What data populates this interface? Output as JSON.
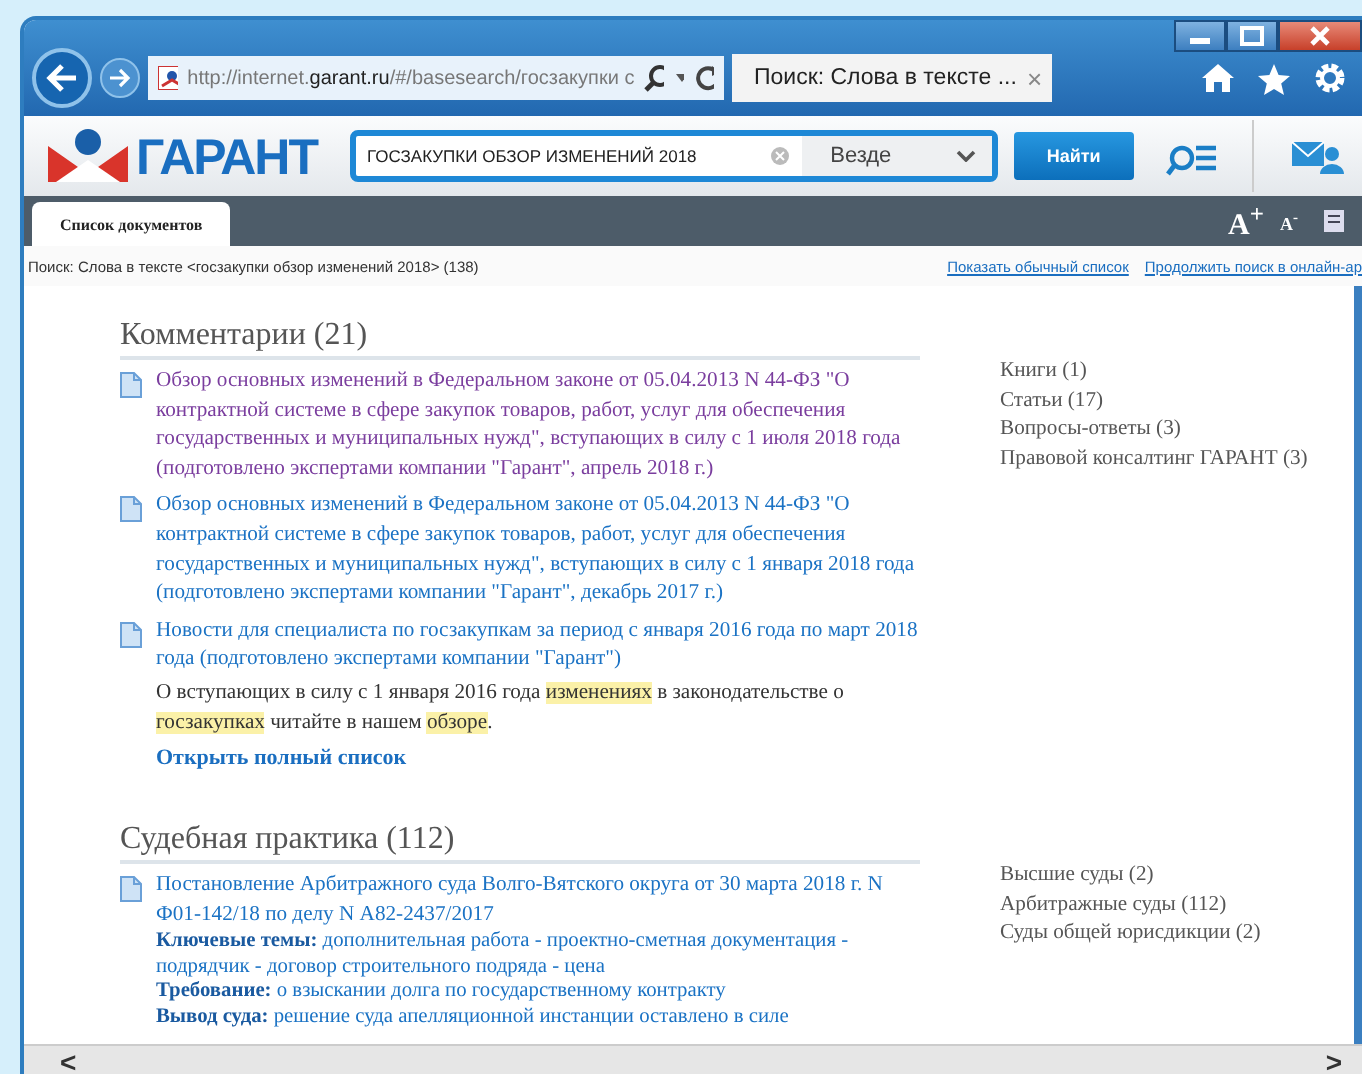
{
  "browser": {
    "address": "http://internet.**garant.ru**/#/basesearch/госзакупки с",
    "tab_title": "Поиск: Слова в тексте ...",
    "tab_close": "×"
  },
  "toolbar": {
    "logo": "ГАРАНТ",
    "search_value": "ГОСЗАКУПКИ ОБЗОР ИЗМЕНЕНИЙ 2018",
    "scope": "Везде",
    "search_button": "Найти"
  },
  "tabs": [
    {
      "label": "Список документов",
      "selected": true
    }
  ],
  "font_buttons": [
    "A$^{+}$",
    "A$^{-}$"
  ],
  "info": {
    "query": "Поиск: Слова в тексте <госзакупки обзор изменений 2018> (138)",
    "links": [
      "Показать обычный список",
      "Продолжить поиск в онлайн-ар"
    ]
  },
  "sections": [
    {
      "title": "Комментарии (21)",
      "items": [
        {
          "title": "Обзор основных изменений в Федеральном законе от 05.04.2013 N 44-ФЗ \"О контрактной системе в сфере закупок товаров, работ, услуг для обеспечения государственных и муниципальных нужд\", вступающих в силу с 1 июля 2018 года (подготовлено экспертами компании \"Гарант\", апрель 2018 г.)",
          "visited": true
        },
        {
          "title": "Обзор основных изменений в Федеральном законе от 05.04.2013 N 44-ФЗ \"О контрактной системе в сфере закупок товаров, работ, услуг для обеспечения государственных и муниципальных нужд\", вступающих в силу с 1 января 2018 года (подготовлено экспертами компании \"Гарант\", декабрь 2017 г.)",
          "visited": false
        },
        {
          "title": "Новости для специалиста по госзакупкам за период с января 2016 года по март 2018 года (подготовлено экспертами компании \"Гарант\")",
          "visited": false,
          "snippet": [
            {
              "text": "О вступающих в силу с 1 января 2016 года ",
              "highlight": false
            },
            {
              "text": "изменениях",
              "highlight": true
            },
            {
              "text": " в законодательстве о ",
              "highlight": false
            },
            {
              "text": "госзакупках",
              "highlight": true
            },
            {
              "text": " читайте в нашем ",
              "highlight": false
            },
            {
              "text": "обзоре",
              "highlight": true
            },
            {
              "text": ".",
              "highlight": false
            }
          ]
        }
      ],
      "more": "Открыть полный список",
      "facets": [
        "Книги (1)",
        "Статьи (17)",
        "Вопросы-ответы (3)",
        "Правовой консалтинг ГАРАНТ (3)"
      ]
    },
    {
      "title": "Судебная практика (112)",
      "items": [
        {
          "title": "Постановление Арбитражного суда Волго-Вятского округа от 30 марта 2018 г. N Ф01-142/18 по делу N А82-2437/2017",
          "visited": false,
          "fields": [
            {
              "label": "Ключевые темы:",
              "text": "дополнительная работа - проектно-сметная документация - подрядчик - договор строительного подряда - цена"
            },
            {
              "label": "Требование:",
              "text": "о взыскании долга по государственному контракту"
            },
            {
              "label": "Вывод суда:",
              "text": "решение суда апелляционной инстанции оставлено в силе"
            }
          ]
        }
      ],
      "facets": [
        "Высшие суды (2)",
        "Арбитражные суды (112)",
        "Суды общей юрисдикции (2)"
      ]
    }
  ],
  "scroll": {
    "left": "<",
    "right": ">"
  }
}
